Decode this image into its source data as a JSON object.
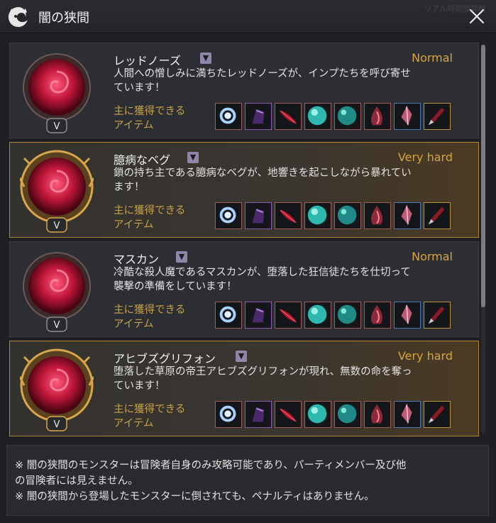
{
  "window": {
    "title": "闇の狭間",
    "watermark": "リアル時間換算時"
  },
  "cards": [
    {
      "name": "レッドノーズ",
      "badge": "V",
      "difficulty": "Normal",
      "desc_line1": "人間への憎しみに満ちたレッドノーズが、インプたちを呼び寄せ",
      "desc_line2": "ています！",
      "items_label_line1": "主に獲得できる",
      "items_label_line2": "アイテム"
    },
    {
      "name": "臆病なベグ",
      "badge": "V",
      "difficulty": "Very hard",
      "desc_line1": "鎖の持ち主である臆病なベグが、地響きを起こしながら暴れてい",
      "desc_line2": "ます！",
      "items_label_line1": "主に獲得できる",
      "items_label_line2": "アイテム"
    },
    {
      "name": "マスカン",
      "badge": "V",
      "difficulty": "Normal",
      "desc_line1": "冷酷な殺人魔であるマスカンが、堕落した狂信徒たちを仕切って",
      "desc_line2": "襲撃の準備をしています！",
      "items_label_line1": "主に獲得できる",
      "items_label_line2": "アイテム"
    },
    {
      "name": "アヒブズグリフォン",
      "badge": "V",
      "difficulty": "Very hard",
      "desc_line1": "堕落した草原の帝王アヒブズグリフォンが現れ、無数の命を奪っ",
      "desc_line2": "ています！",
      "items_label_line1": "主に獲得できる",
      "items_label_line2": "アイテム"
    }
  ],
  "notice": {
    "line1": "※ 闇の狭間のモンスターは冒険者自身のみ攻略可能であり、パーティメンバー及び他",
    "line2": "の冒険者には見えません。",
    "line3": "※ 闇の狭間から登場したモンスターに倒されても、ペナルティはありません。"
  },
  "colors": {
    "normal": "#d9a33a",
    "very_hard": "#d9a33a",
    "hard_border": "#b08437"
  }
}
